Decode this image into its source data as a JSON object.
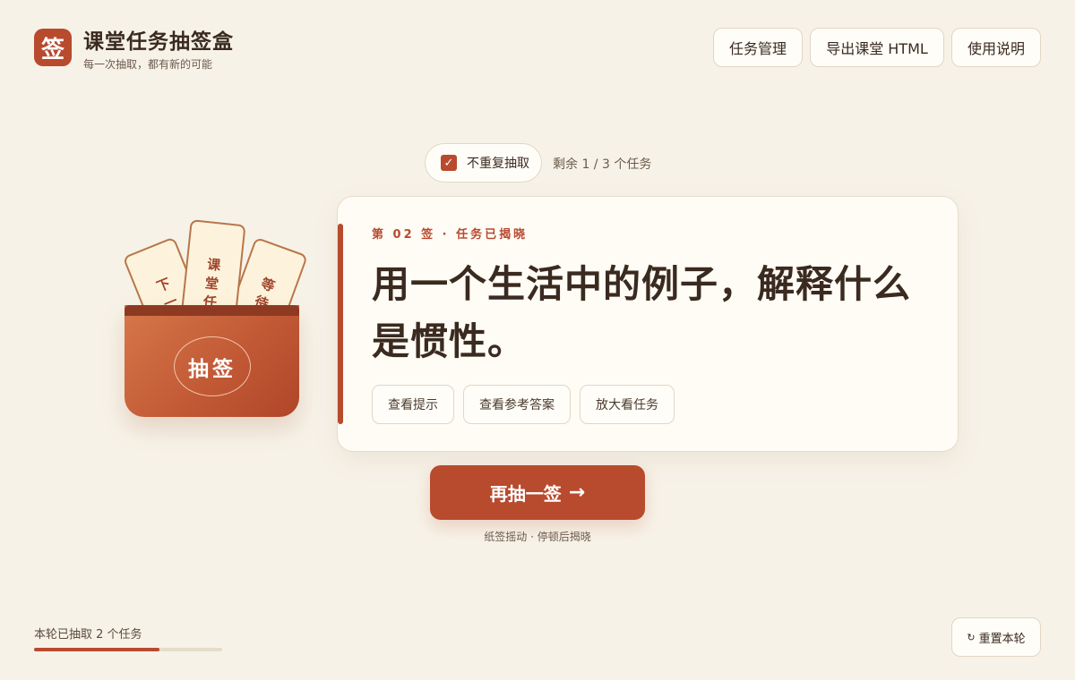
{
  "header": {
    "logo_glyph": "签",
    "title": "课堂任务抽签盒",
    "subtitle": "每一次抽取，都有新的可能",
    "buttons": [
      "任务管理",
      "导出课堂 HTML",
      "使用说明"
    ]
  },
  "controls": {
    "no_repeat_label": "不重复抽取",
    "no_repeat_checked": true,
    "checkmark": "✓",
    "remaining_text": "剩余 1 / 3 个任务"
  },
  "box": {
    "tickets": [
      {
        "chars": [
          "下",
          "一"
        ]
      },
      {
        "chars": [
          "课",
          "堂",
          "任"
        ]
      },
      {
        "chars": [
          "等",
          "待"
        ]
      }
    ],
    "badge": "抽签"
  },
  "card": {
    "meta": "第 02 签 · 任务已揭晓",
    "title": "用一个生活中的例子，解释什么是惯性。",
    "actions": [
      "查看提示",
      "查看参考答案",
      "放大看任务"
    ]
  },
  "draw": {
    "label": "再抽一签",
    "arrow": "→",
    "hint": "纸签摇动 · 停顿后揭晓"
  },
  "footer": {
    "round_text": "本轮已抽取 2 个任务",
    "progress_fraction": 0.667,
    "reset_icon": "↻",
    "reset_label": "重置本轮"
  },
  "colors": {
    "accent": "#b84a2e",
    "background": "#f7f2e8",
    "ticket": "#fdf3dc"
  }
}
